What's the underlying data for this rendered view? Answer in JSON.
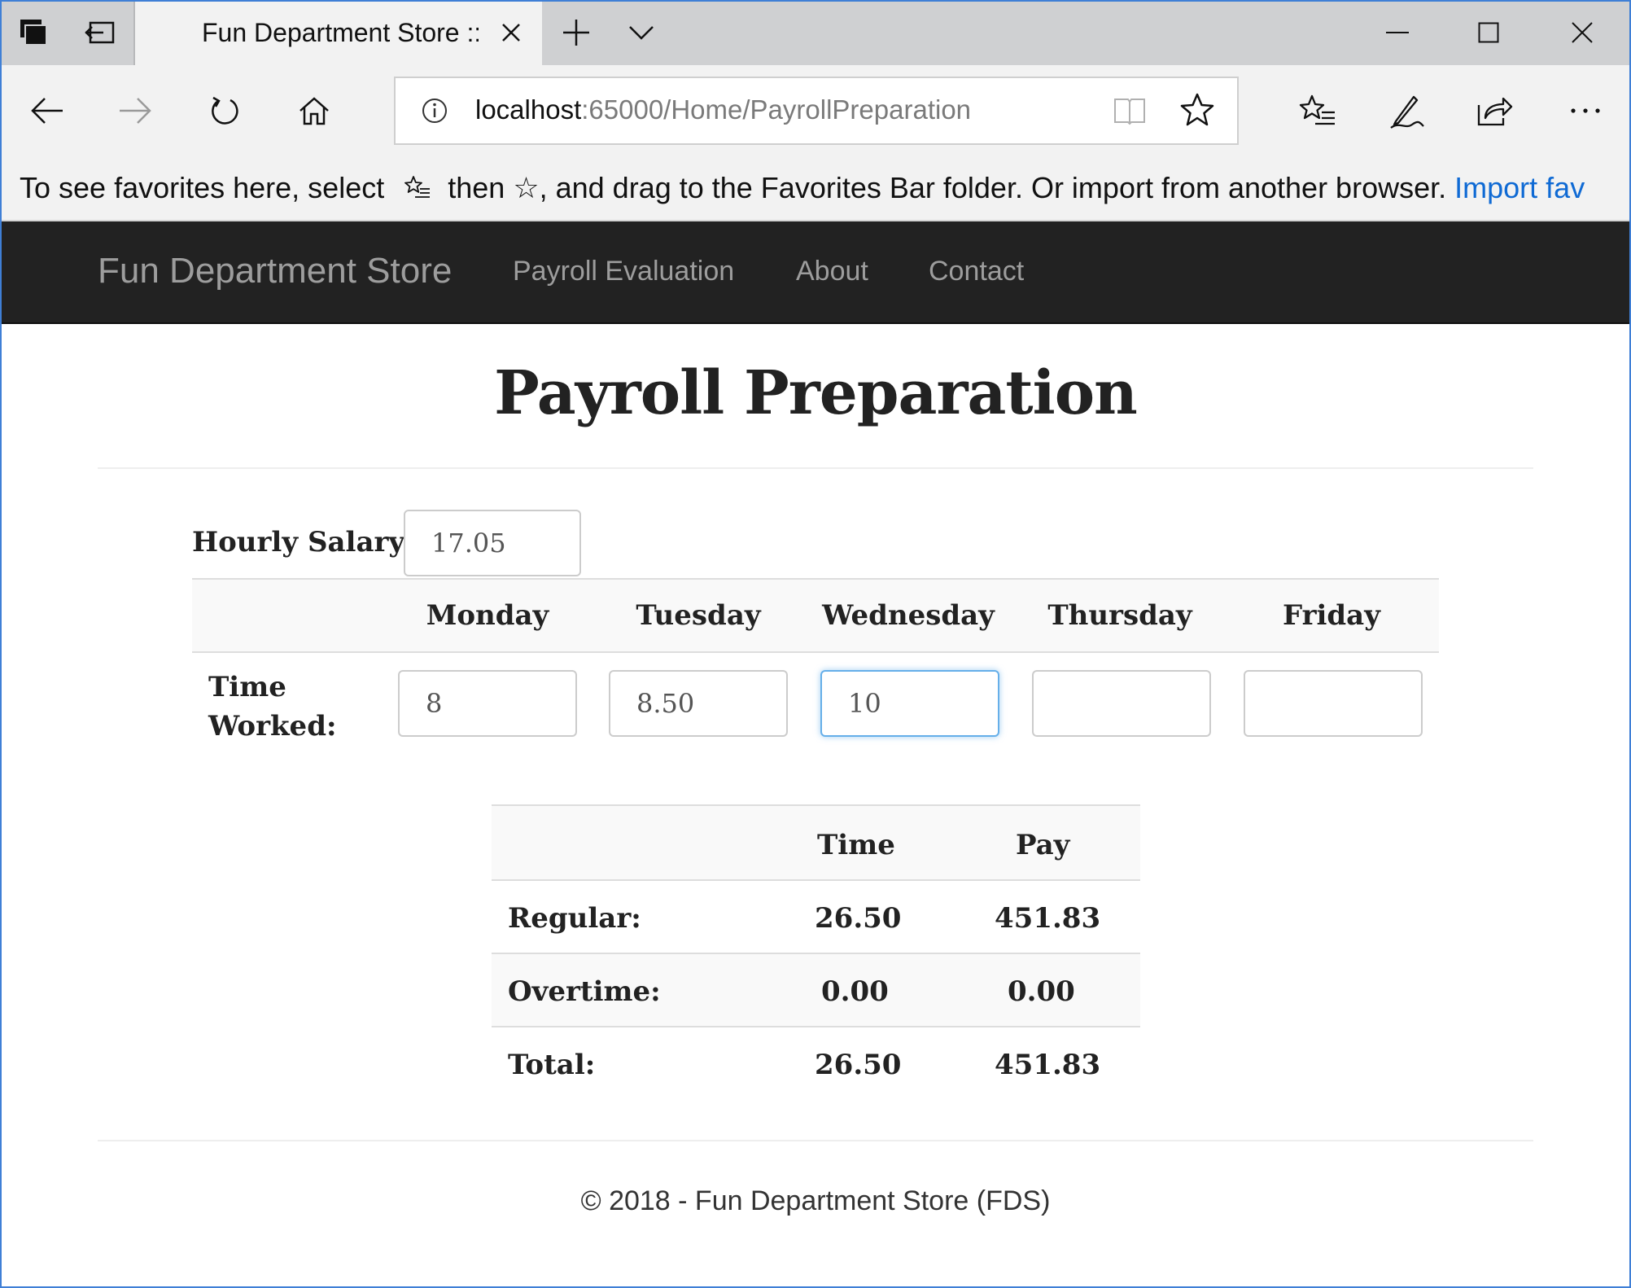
{
  "browser": {
    "tab_title": "Fun Department Store ::",
    "address_host": "localhost",
    "address_path": ":65000/Home/PayrollPreparation",
    "favorites_text_1": "To see favorites here, select",
    "favorites_text_2": "then ☆, and drag to the Favorites Bar folder. Or import from another browser.",
    "favorites_link": "Import fav"
  },
  "site_nav": {
    "brand": "Fun Department Store",
    "links": [
      "Payroll Evaluation",
      "About",
      "Contact"
    ]
  },
  "page": {
    "title": "Payroll Preparation",
    "hourly_salary_label": "Hourly Salary:",
    "hourly_salary_value": "17.05",
    "days": [
      "Monday",
      "Tuesday",
      "Wednesday",
      "Thursday",
      "Friday"
    ],
    "time_worked_label_1": "Time",
    "time_worked_label_2": "Worked:",
    "time_worked": [
      "8",
      "8.50",
      "10",
      "",
      ""
    ]
  },
  "summary": {
    "headers": [
      "",
      "Time",
      "Pay"
    ],
    "rows": [
      {
        "label": "Regular:",
        "time": "26.50",
        "pay": "451.83"
      },
      {
        "label": "Overtime:",
        "time": "0.00",
        "pay": "0.00"
      },
      {
        "label": "Total:",
        "time": "26.50",
        "pay": "451.83"
      }
    ]
  },
  "footer": {
    "text": "© 2018 - Fun Department Store (FDS)"
  },
  "colors": {
    "navbar_bg": "#222222",
    "nav_text": "#9d9d9d",
    "link_blue": "#0f6ad4",
    "focus_border": "#66afe9"
  }
}
